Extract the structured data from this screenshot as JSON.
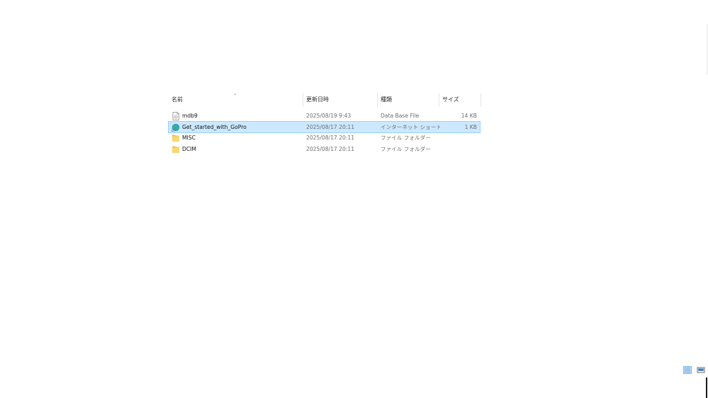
{
  "columns": {
    "name": "名前",
    "date": "更新日時",
    "type": "種類",
    "size": "サイズ"
  },
  "files": [
    {
      "name": "mdb9",
      "date": "2025/08/19 9:43",
      "type": "Data Base File",
      "size": "14 KB",
      "icon": "database-file-icon",
      "selected": false
    },
    {
      "name": "Get_started_with_GoPro",
      "date": "2025/08/17 20:11",
      "type": "インターネット ショート...",
      "size": "1 KB",
      "icon": "internet-shortcut-icon",
      "selected": true
    },
    {
      "name": "MISC",
      "date": "2025/08/17 20:11",
      "type": "ファイル フォルダー",
      "size": "",
      "icon": "folder-icon",
      "selected": false
    },
    {
      "name": "DCIM",
      "date": "2025/08/17 20:11",
      "type": "ファイル フォルダー",
      "size": "",
      "icon": "folder-icon",
      "selected": false
    }
  ],
  "colors": {
    "selection_bg": "#cce8ff",
    "selection_border": "#99d1ff",
    "folder": "#f8d775",
    "secondary_text": "#6d6d6d"
  },
  "view_modes": [
    "details-view-icon",
    "large-icons-view-icon"
  ]
}
